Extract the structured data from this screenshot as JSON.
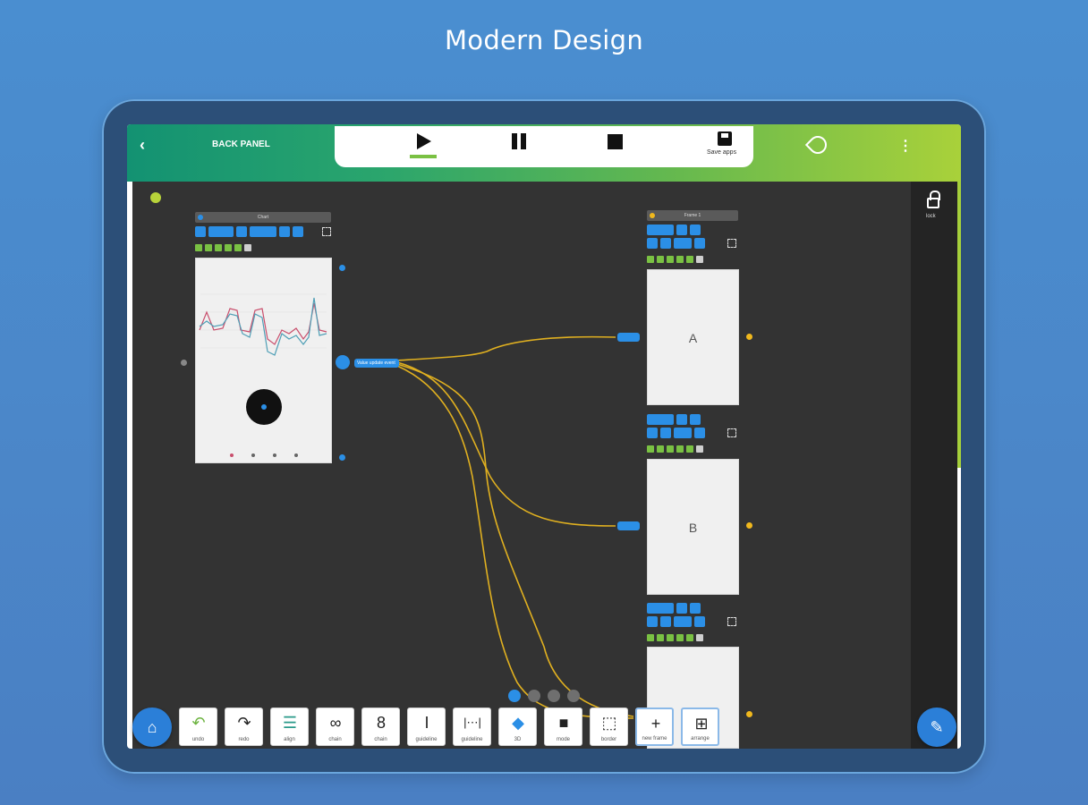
{
  "headline": "Modern Design",
  "appbar": {
    "back_label": "BACK PANEL",
    "save_label": "Save apps"
  },
  "rightpanel": {
    "lock_label": "lock"
  },
  "nodes": {
    "main_screen": {
      "title": "Chart"
    },
    "screen_a": {
      "title": "Frame 1",
      "letter": "A"
    },
    "screen_b": {
      "letter": "B"
    }
  },
  "connector_label": "Value update event",
  "bottom_tools": [
    {
      "name": "undo",
      "icon": "undo-icon",
      "label": "undo"
    },
    {
      "name": "redo",
      "icon": "redo-icon",
      "label": "redo"
    },
    {
      "name": "align",
      "icon": "align-icon",
      "label": "align"
    },
    {
      "name": "chain",
      "icon": "link-icon",
      "label": "chain"
    },
    {
      "name": "chain2",
      "icon": "chain-icon",
      "label": "chain"
    },
    {
      "name": "guideline",
      "icon": "guideline-icon",
      "label": "guideline"
    },
    {
      "name": "guideline2",
      "icon": "guideline-h-icon",
      "label": "guideline"
    },
    {
      "name": "3d",
      "icon": "cube-icon",
      "label": "3D"
    },
    {
      "name": "mode",
      "icon": "lock-icon",
      "label": "mode"
    },
    {
      "name": "border",
      "icon": "border-icon",
      "label": "border"
    },
    {
      "name": "new-frame",
      "icon": "plus-icon",
      "label": "new frame"
    },
    {
      "name": "arrange",
      "icon": "grid-icon",
      "label": "arrange"
    }
  ],
  "pager": {
    "pages": 4,
    "active": 1
  },
  "colors": {
    "accent_blue": "#2b8fe6",
    "wire": "#e0b020",
    "canvas": "#333333",
    "appbar_start": "#139272",
    "appbar_end": "#a9d13a"
  }
}
